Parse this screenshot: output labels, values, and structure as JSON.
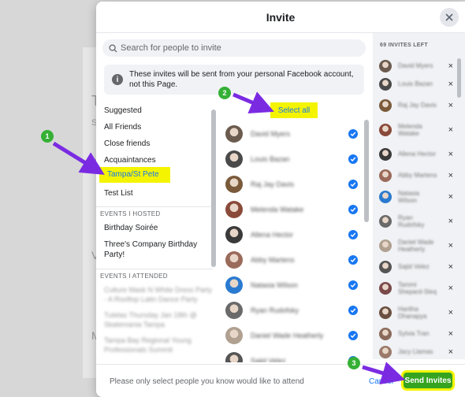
{
  "background": {
    "fragments": [
      "T",
      "S",
      "Y",
      "V",
      "M"
    ]
  },
  "modal": {
    "title": "Invite",
    "search": {
      "placeholder": "Search for people to invite"
    },
    "notice": "These invites will be sent from your personal Facebook account, not this Page.",
    "categories": [
      {
        "label": "Suggested",
        "active": false
      },
      {
        "label": "All Friends",
        "active": false
      },
      {
        "label": "Close friends",
        "active": false
      },
      {
        "label": "Acquaintances",
        "active": false
      },
      {
        "label": "Tampa/St Pete",
        "active": true
      },
      {
        "label": "Test List",
        "active": false
      }
    ],
    "events_hosted": {
      "heading": "EVENTS I HOSTED",
      "items": [
        "Birthday Soirée",
        "Three's Company Birthday Party!"
      ]
    },
    "events_attended": {
      "heading": "EVENTS I ATTENDED",
      "items": [
        "Culture Mask N White Dress Party - A Rooftop Latin Dance Party",
        "Tutelas Thursday Jan 18th @ Skatemania Tampa",
        "Tampa Bay Regional Young Professionals Summit"
      ]
    },
    "select_all": "Select all",
    "friends": [
      {
        "name": "David Myers",
        "color": "#6b5b4e"
      },
      {
        "name": "Louis Bazan",
        "color": "#4a4a4a"
      },
      {
        "name": "Raj Jay Davis",
        "color": "#7a5a3a"
      },
      {
        "name": "Melenda Watake",
        "color": "#8a4a3a"
      },
      {
        "name": "Allena Hector",
        "color": "#3a3a3a"
      },
      {
        "name": "Abby Martens",
        "color": "#9a6a5a"
      },
      {
        "name": "Natasia Wilson",
        "color": "#2a7ad0"
      },
      {
        "name": "Ryan Rudofsky",
        "color": "#6a6a6a"
      },
      {
        "name": "Daniel Wade Heatherly",
        "color": "#b0a090"
      },
      {
        "name": "Sajid Velez",
        "color": "#555555"
      }
    ],
    "invites_left": "69 INVITES LEFT",
    "selected": [
      {
        "name": "David Myers",
        "color": "#6b5b4e"
      },
      {
        "name": "Louis Bazan",
        "color": "#4a4a4a"
      },
      {
        "name": "Raj Jay Davis",
        "color": "#7a5a3a"
      },
      {
        "name": "Melenda Watake",
        "color": "#8a4a3a"
      },
      {
        "name": "Allena Hector",
        "color": "#3a3a3a"
      },
      {
        "name": "Abby Martens",
        "color": "#9a6a5a"
      },
      {
        "name": "Natasia Wilson",
        "color": "#2a7ad0"
      },
      {
        "name": "Ryan Rudofsky",
        "color": "#6a6a6a"
      },
      {
        "name": "Daniel Wade Heatherly",
        "color": "#b0a090"
      },
      {
        "name": "Sajid Velez",
        "color": "#555555"
      },
      {
        "name": "Tammi Shepard-Sleq",
        "color": "#7a4a4a"
      },
      {
        "name": "Haritha Dhanapya",
        "color": "#6a5040"
      },
      {
        "name": "Sylvia Tran",
        "color": "#8a6a5a"
      },
      {
        "name": "Jacy Llamas",
        "color": "#9a7a6a"
      }
    ],
    "footer": {
      "text": "Please only select people you know would like to attend",
      "cancel": "Cancel",
      "send": "Send Invites"
    }
  },
  "annotations": {
    "one": "1",
    "two": "2",
    "three": "3"
  },
  "colors": {
    "accent": "#1877f2",
    "send": "#36a420",
    "highlight": "#f4f400",
    "annotation": "#35b035",
    "arrow": "#7a2be2"
  }
}
